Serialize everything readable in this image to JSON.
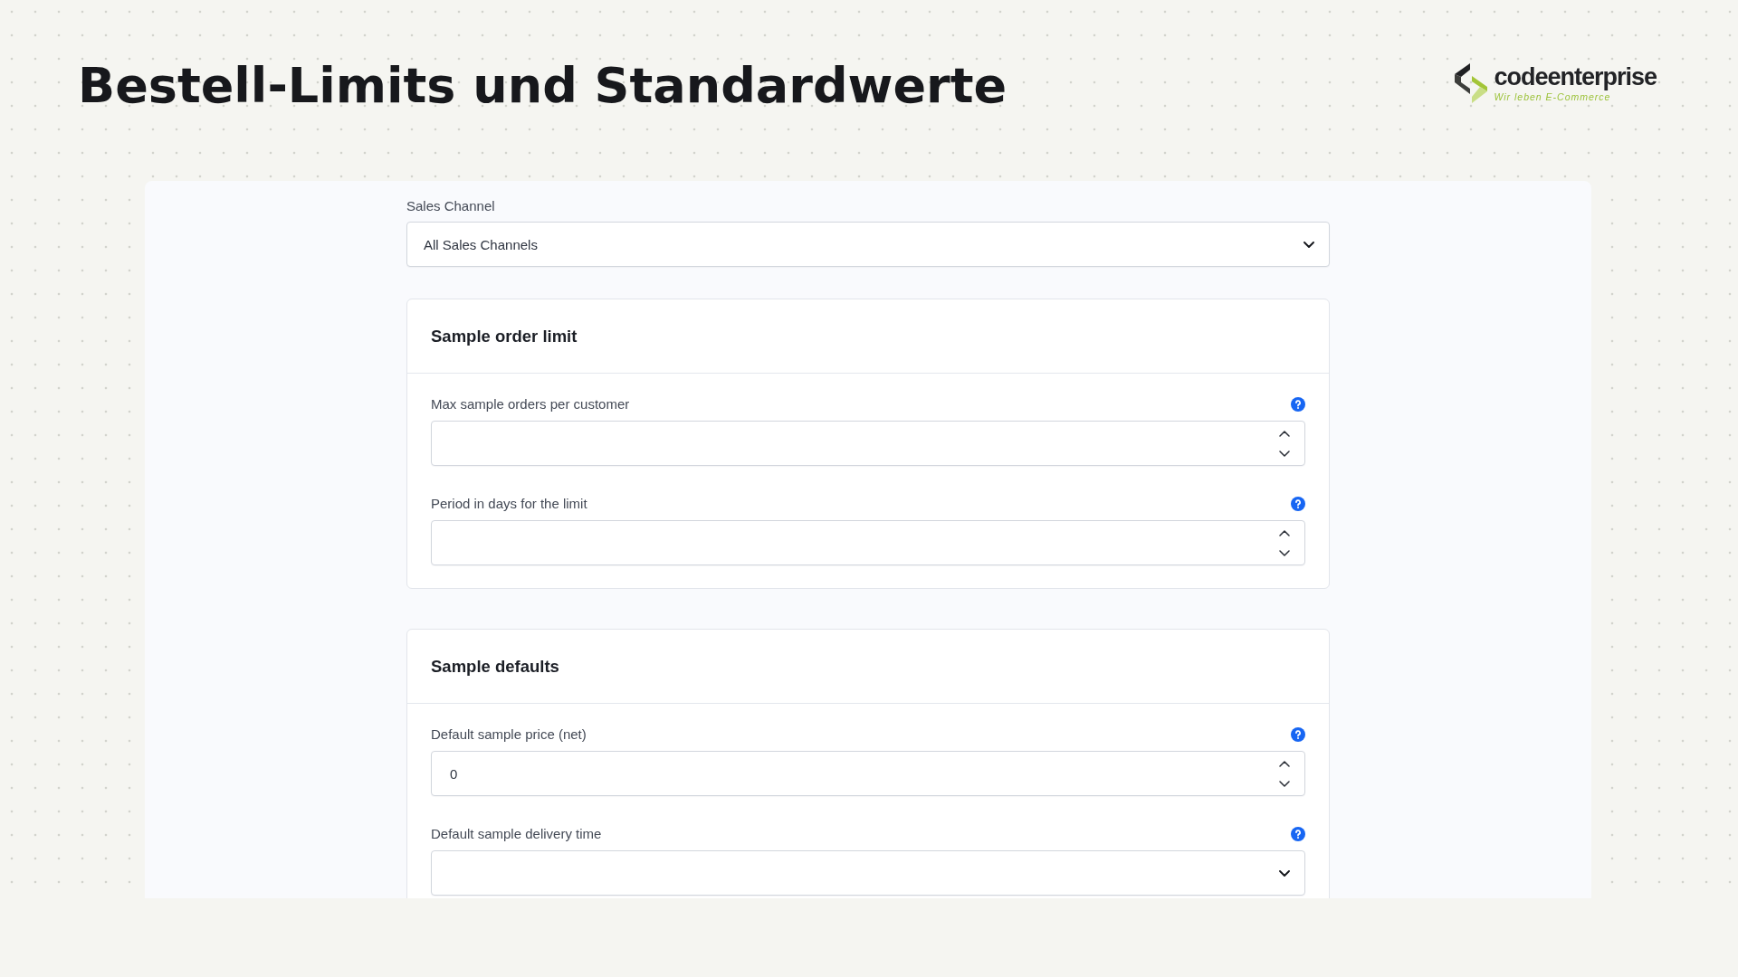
{
  "page": {
    "title": "Bestell-Limits und Standardwerte"
  },
  "logo": {
    "name": "codeenterprise",
    "tagline": "Wir leben E-Commerce"
  },
  "sales_channel": {
    "label": "Sales Channel",
    "value": "All Sales Channels"
  },
  "cards": [
    {
      "title": "Sample order limit",
      "fields": [
        {
          "kind": "number",
          "label": "Max sample orders per customer"
        },
        {
          "kind": "number",
          "label": "Period in days for the limit"
        }
      ]
    },
    {
      "title": "Sample defaults",
      "fields": [
        {
          "kind": "number",
          "label": "Default sample price (net)",
          "value": "0"
        },
        {
          "kind": "select",
          "label": "Default sample delivery time"
        }
      ]
    }
  ]
}
